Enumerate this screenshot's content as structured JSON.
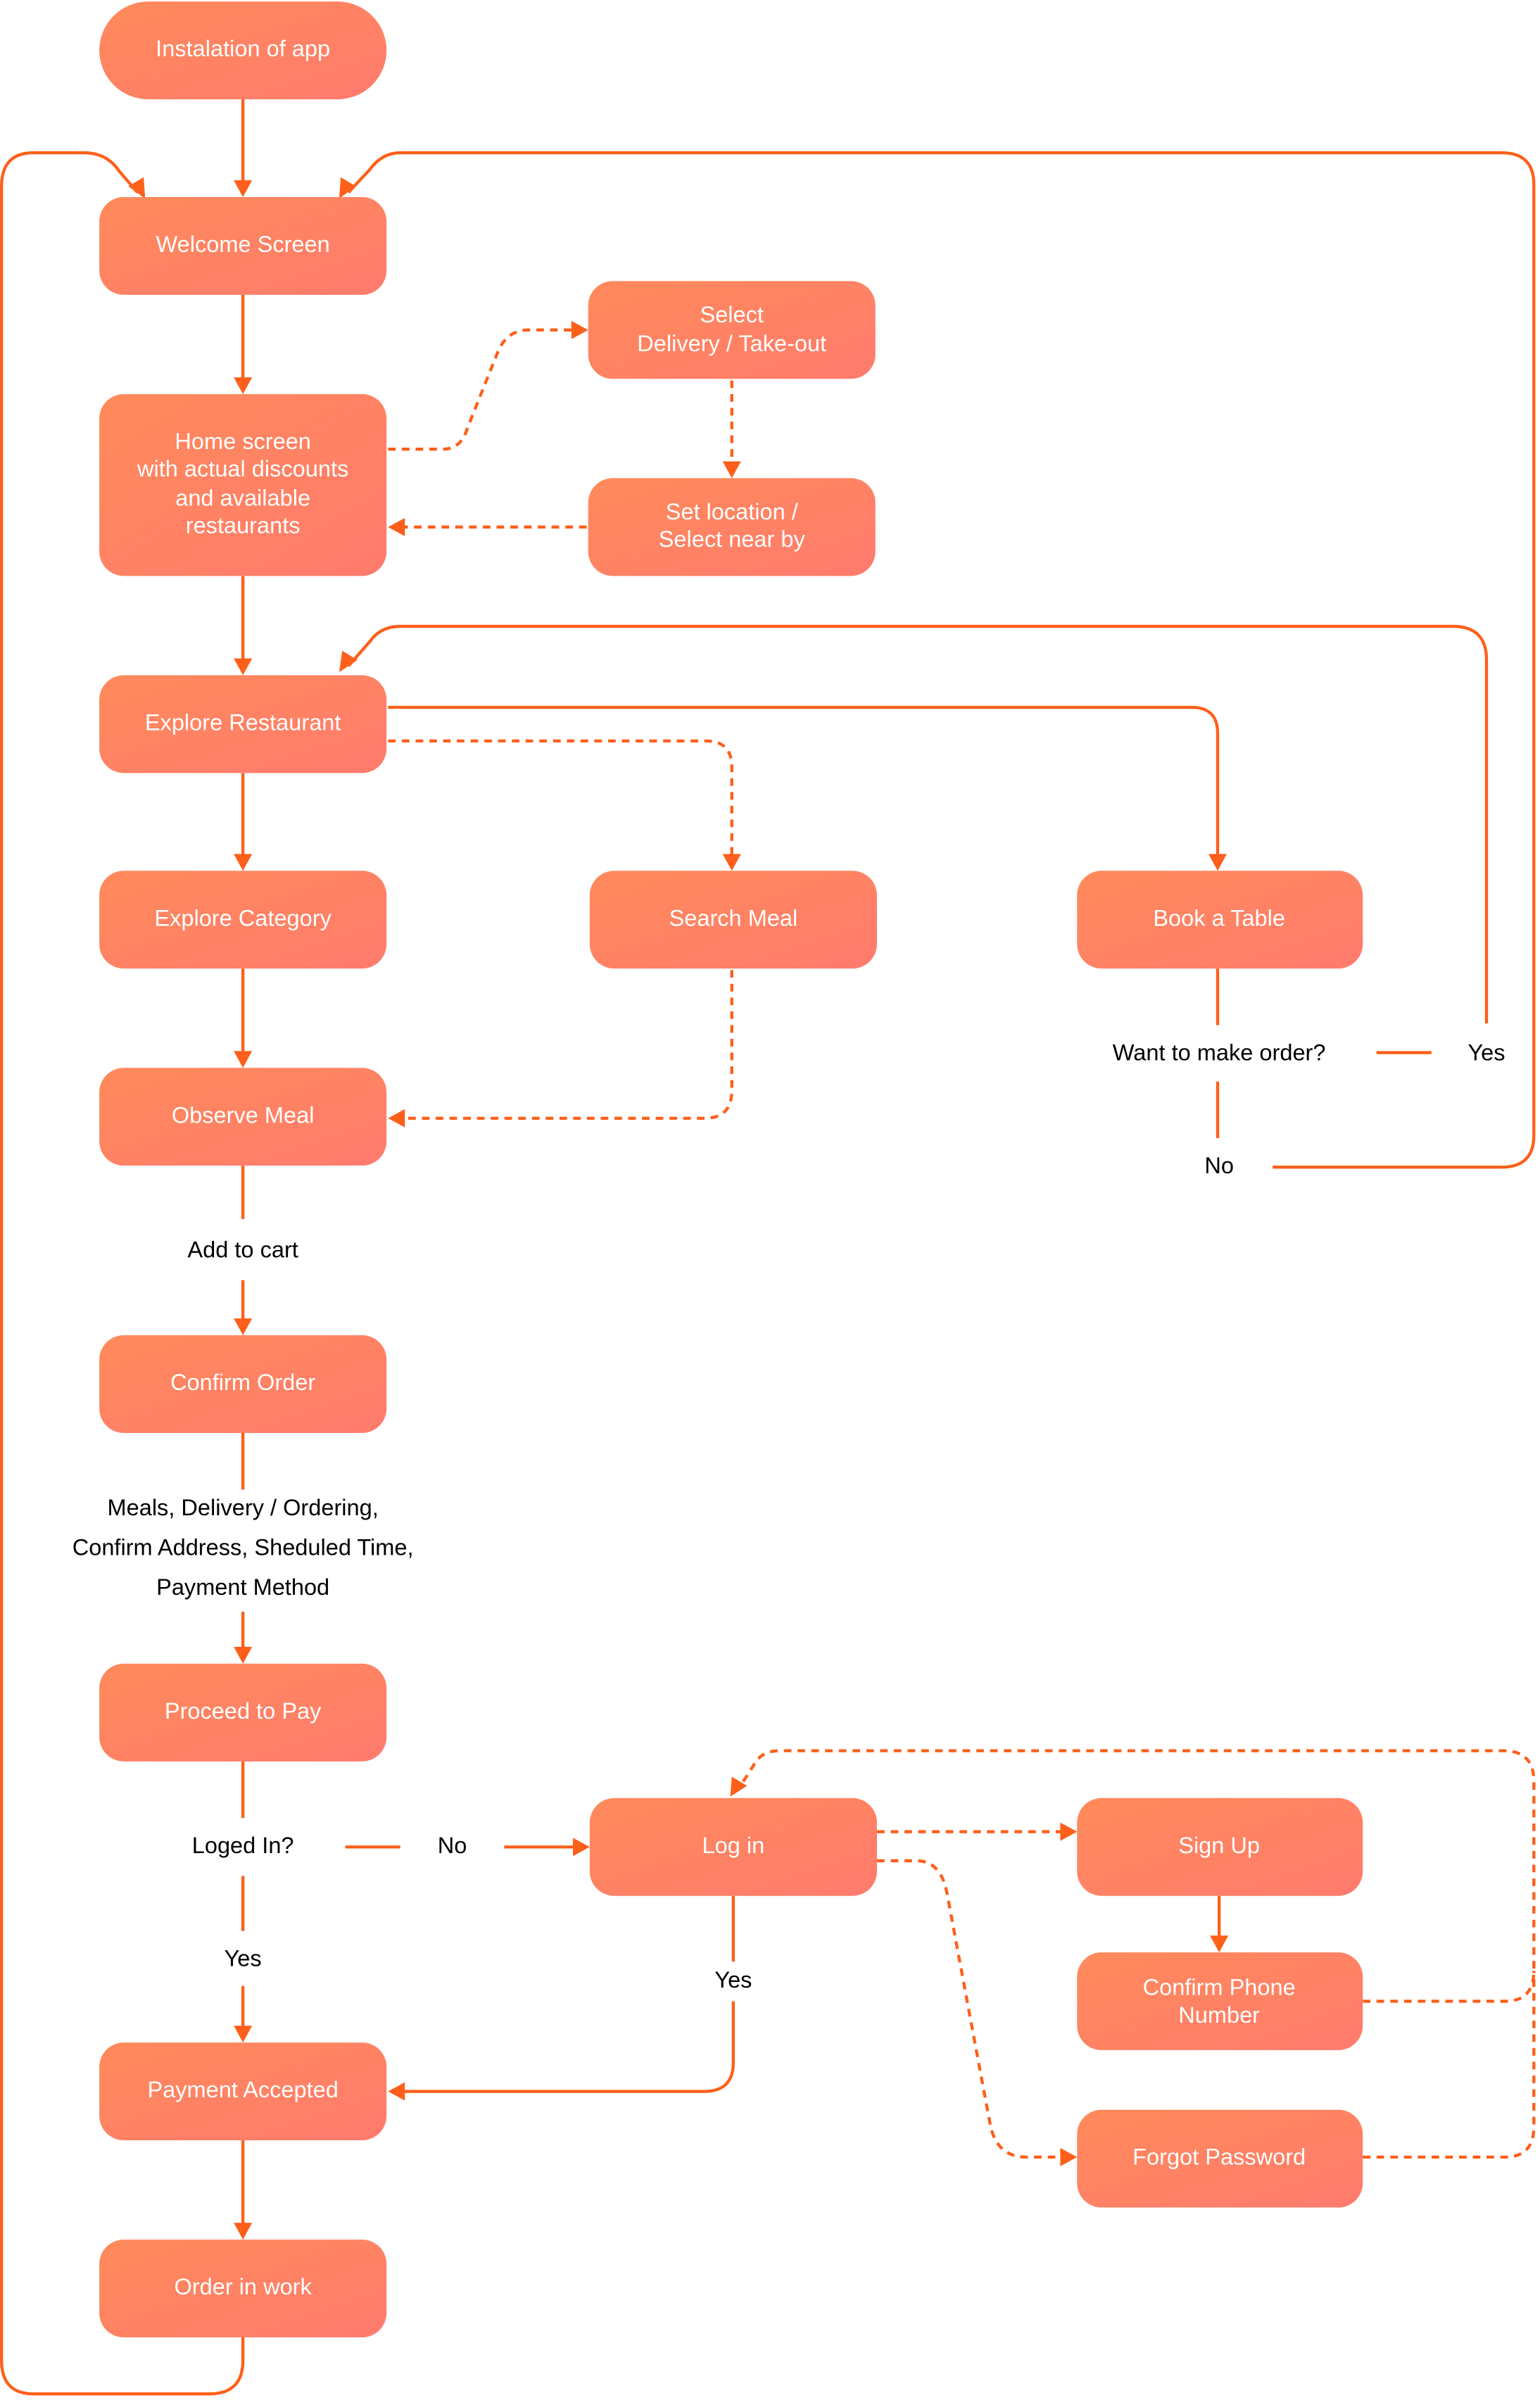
{
  "colors": {
    "accent": "#fe5f1a",
    "box_start": "#ff8a5a",
    "box_end": "#ff7b6e",
    "text_on_box": "#ffffff",
    "label_text": "#000000"
  },
  "nodes": {
    "install": "Instalation of app",
    "welcome": "Welcome Screen",
    "home": [
      "Home screen",
      "with actual discounts",
      "and available",
      "restaurants"
    ],
    "delivery": [
      "Select",
      "Delivery / Take-out"
    ],
    "location": [
      "Set location /",
      "Select near by"
    ],
    "explore_restaurant": "Explore Restaurant",
    "explore_category": "Explore Category",
    "search_meal": "Search Meal",
    "book_table": "Book a Table",
    "observe_meal": "Observe Meal",
    "confirm_order": "Confirm Order",
    "proceed_pay": "Proceed to Pay",
    "login": "Log in",
    "signup": "Sign Up",
    "confirm_phone": [
      "Confirm Phone",
      "Number"
    ],
    "forgot_password": "Forgot Password",
    "payment_accepted": "Payment Accepted",
    "order_in_work": "Order in work"
  },
  "labels": {
    "want_order": "Want to make order?",
    "yes_order": "Yes",
    "no_order": "No",
    "add_to_cart": "Add to cart",
    "order_details": [
      "Meals, Delivery / Ordering,",
      "Confirm Address, Sheduled Time,",
      "Payment Method"
    ],
    "loged_in": "Loged In?",
    "no_login": "No",
    "yes_login": "Yes",
    "yes_login_success": "Yes"
  }
}
